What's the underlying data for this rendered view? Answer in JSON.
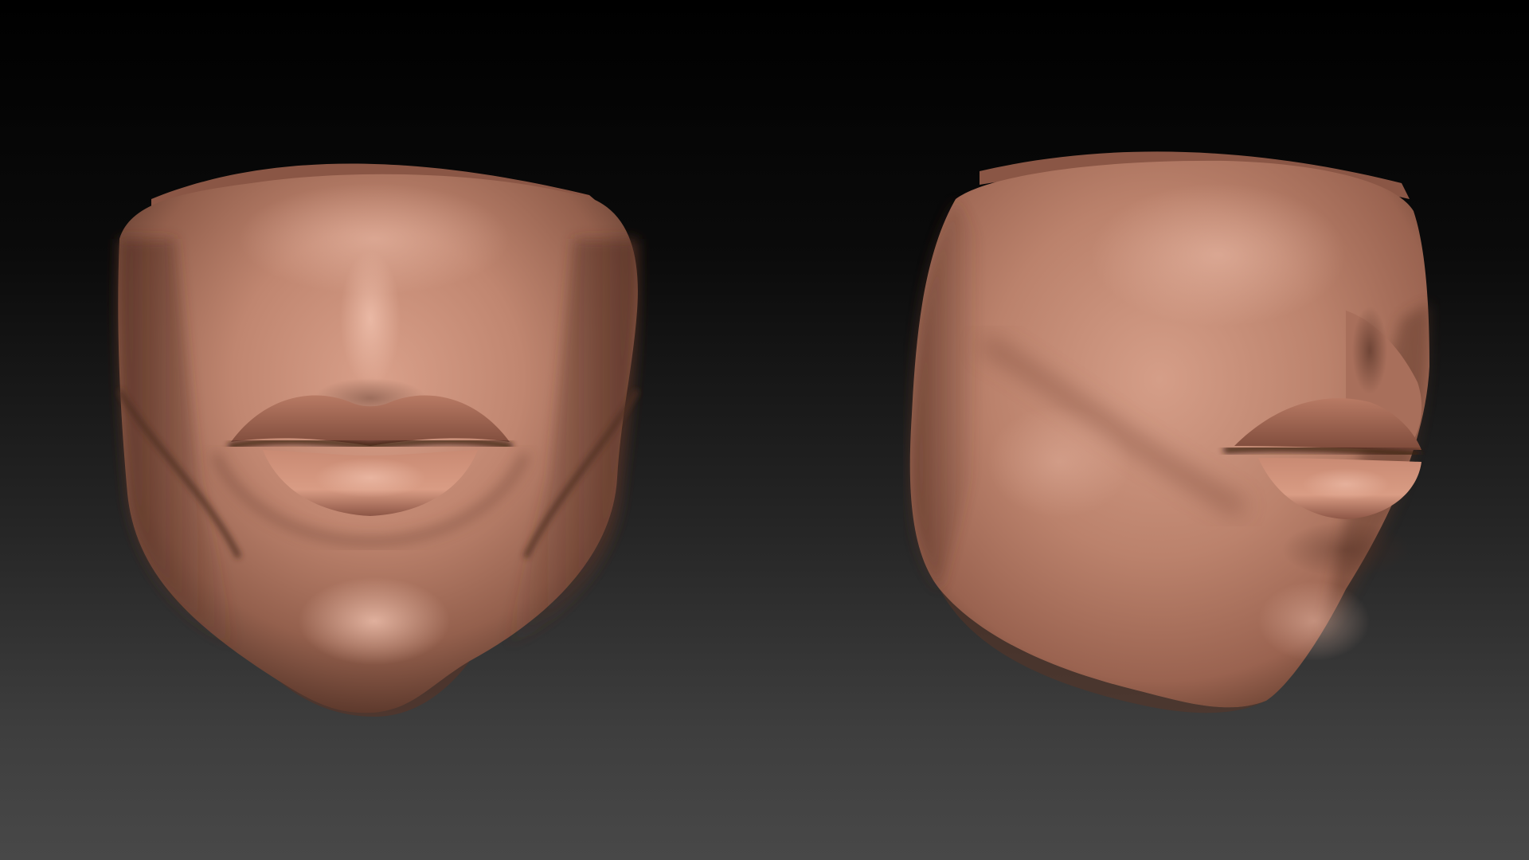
{
  "scene": {
    "background_top": "#000000",
    "background_bottom": "#484848",
    "material_base": "#b8836d",
    "material_light": "#e6b29d",
    "material_shadow": "#5a3427"
  },
  "models": [
    {
      "view": "front",
      "name": "mouth-sculpt-front"
    },
    {
      "view": "three-quarter",
      "name": "mouth-sculpt-side"
    }
  ]
}
